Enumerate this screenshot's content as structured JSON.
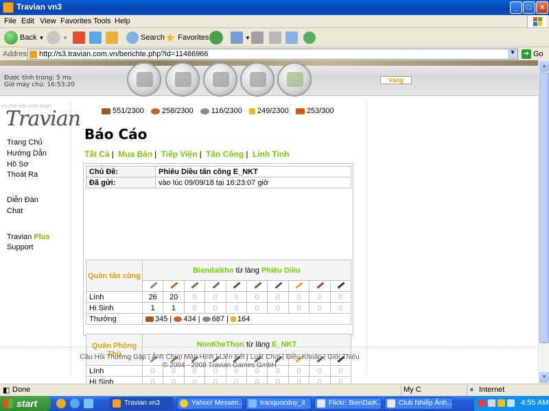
{
  "window": {
    "title": "Travian vn3"
  },
  "menu": [
    "File",
    "Edit",
    "View",
    "Favorites",
    "Tools",
    "Help"
  ],
  "toolbar": {
    "back": "Back",
    "search": "Search",
    "favorites": "Favorites"
  },
  "address": {
    "label": "Address",
    "url": "http://s3.travian.com.vn/berichte.php?id=11486966",
    "go": "Go"
  },
  "banner": {
    "timing_line1": "Được tính trong: 5 ms",
    "timing_line2": "Giờ máy chủ: 16:53:20",
    "gold_button": "Vàng"
  },
  "logo": {
    "text": "Travian",
    "subtext": "trò chơi trên trình duyệt"
  },
  "side_menu": {
    "home": "Trang Chủ",
    "guide": "Hướng Dẫn",
    "profile": "Hồ Sơ",
    "logout": "Thoát Ra",
    "forum": "Diễn Đàn",
    "chat": "Chat",
    "plus_prefix": "Travian",
    "plus_suffix": "Plus",
    "support": "Support"
  },
  "resources": {
    "wood": "551/2300",
    "clay": "258/2300",
    "iron": "116/2300",
    "crop": "249/2300",
    "consumption": "253/300"
  },
  "report": {
    "heading": "Báo Cáo",
    "tabs": [
      "Tất Cả",
      "Mua Bán",
      "Tiếp Viện",
      "Tấn Công",
      "Linh Tinh"
    ],
    "subject_label": "Chủ Đề:",
    "subject": "Phiêu Diều tấn công E_NKT",
    "sent_label": "Đã gửi:",
    "sent": "vào lúc 09/09/18 tại 16:23:07 giờ",
    "attacker": {
      "role": "Quân tấn công",
      "player": "Biendaikho",
      "from": "từ làng",
      "village": "Phiêu Diều",
      "troops_label": "Lính",
      "troops": [
        "26",
        "20",
        "0",
        "0",
        "0",
        "0",
        "0",
        "0",
        "0",
        "0"
      ],
      "losses_label": "Hi Sinh",
      "losses": [
        "1",
        "1",
        "0",
        "0",
        "0",
        "0",
        "0",
        "0",
        "0",
        "0"
      ],
      "bounty_label": "Thưởng",
      "bounty": {
        "wood": "345",
        "clay": "434",
        "iron": "687",
        "crop": "164"
      }
    },
    "defender": {
      "role": "Quân Phòng Thủ",
      "player": "NonKheThon",
      "from": "từ làng",
      "village": "E_NKT",
      "troops_label": "Lính",
      "troops": [
        "0",
        "0",
        "0",
        "0",
        "0",
        "0",
        "0",
        "0",
        "0",
        "0"
      ],
      "losses_label": "Hi Sinh",
      "losses": [
        "0",
        "0",
        "0",
        "0",
        "0",
        "0",
        "0",
        "0",
        "0",
        "0"
      ]
    }
  },
  "footer": {
    "links": [
      "Câu Hỏi Thường Gặp",
      "Ảnh Chụp Màn Hình",
      "Liên Kết",
      "Luật Chơi",
      "Điều Khoản",
      "Giới Thiệu"
    ],
    "copyright": "© 2004 - 2008 Travian Games GmbH"
  },
  "statusbar": {
    "status": "Done",
    "middle": "My C",
    "zone": "Internet"
  },
  "taskbar": {
    "start": "start",
    "tasks": [
      "Travian vn3",
      "Yahoo! Messen...",
      "tranquocduy_it",
      "Flickr: BienDaiK...",
      "Club Nhiếp Ảnh..."
    ],
    "clock": "4:55 AM"
  },
  "colors": {
    "accent_green": "#71d000",
    "gold": "#e0a000",
    "xp_blue": "#245edb"
  },
  "icons": {
    "nav": [
      "village-overview-icon",
      "village-center-icon",
      "map-icon",
      "statistics-icon",
      "reports-icon"
    ],
    "troops": [
      "legionnaire-icon",
      "praetorian-icon",
      "imperian-icon",
      "equites-legati-icon",
      "equites-imperatoris-icon",
      "equites-caesaris-icon",
      "battering-ram-icon",
      "fire-catapult-icon",
      "senator-icon",
      "settler-icon"
    ]
  }
}
